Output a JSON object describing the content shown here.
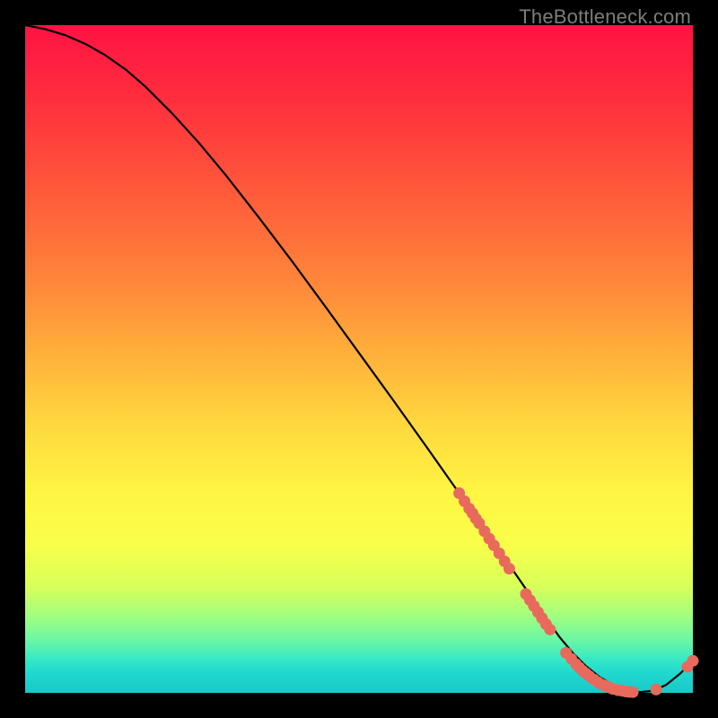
{
  "watermark": "TheBottleneck.com",
  "colors": {
    "dot": "#e86a5c",
    "curve": "#000000"
  },
  "chart_data": {
    "type": "line",
    "title": "",
    "xlabel": "",
    "ylabel": "",
    "xlim": [
      0,
      100
    ],
    "ylim": [
      0,
      100
    ],
    "grid": false,
    "legend": false,
    "series": [
      {
        "name": "curve",
        "x": [
          0,
          3,
          6,
          9,
          12,
          15,
          18,
          22,
          26,
          30,
          35,
          40,
          45,
          50,
          55,
          60,
          65,
          68,
          70,
          72,
          74,
          76,
          78,
          80,
          82,
          84,
          86,
          88,
          90,
          92,
          94,
          96,
          98,
          100
        ],
        "y": [
          100,
          99.4,
          98.5,
          97.2,
          95.5,
          93.4,
          90.8,
          86.8,
          82.4,
          77.6,
          71.2,
          64.6,
          57.8,
          50.9,
          44.0,
          37.0,
          29.9,
          25.6,
          22.8,
          19.9,
          17.0,
          14.1,
          11.2,
          8.4,
          6.0,
          4.0,
          2.4,
          1.2,
          0.4,
          0.1,
          0.3,
          1.2,
          2.8,
          4.8
        ]
      }
    ],
    "scatter": [
      {
        "name": "cluster1",
        "points": [
          {
            "x": 65.0,
            "y": 29.9
          },
          {
            "x": 65.8,
            "y": 28.7
          },
          {
            "x": 66.5,
            "y": 27.6
          },
          {
            "x": 67.0,
            "y": 26.9
          },
          {
            "x": 67.5,
            "y": 26.1
          },
          {
            "x": 68.0,
            "y": 25.4
          },
          {
            "x": 68.8,
            "y": 24.2
          },
          {
            "x": 69.5,
            "y": 23.1
          },
          {
            "x": 70.2,
            "y": 22.1
          },
          {
            "x": 71.0,
            "y": 20.9
          },
          {
            "x": 71.8,
            "y": 19.7
          },
          {
            "x": 72.5,
            "y": 18.6
          }
        ]
      },
      {
        "name": "cluster2",
        "points": [
          {
            "x": 75.0,
            "y": 14.8
          },
          {
            "x": 75.6,
            "y": 13.9
          },
          {
            "x": 76.2,
            "y": 13.0
          },
          {
            "x": 76.8,
            "y": 12.1
          },
          {
            "x": 77.4,
            "y": 11.2
          },
          {
            "x": 78.0,
            "y": 10.3
          },
          {
            "x": 78.6,
            "y": 9.5
          }
        ]
      },
      {
        "name": "cluster3",
        "points": [
          {
            "x": 81.0,
            "y": 6.0
          },
          {
            "x": 81.8,
            "y": 5.1
          },
          {
            "x": 82.5,
            "y": 4.3
          },
          {
            "x": 83.0,
            "y": 3.8
          },
          {
            "x": 83.5,
            "y": 3.3
          },
          {
            "x": 84.0,
            "y": 2.9
          },
          {
            "x": 84.5,
            "y": 2.5
          },
          {
            "x": 85.2,
            "y": 2.0
          },
          {
            "x": 85.8,
            "y": 1.6
          },
          {
            "x": 86.5,
            "y": 1.2
          },
          {
            "x": 87.0,
            "y": 1.0
          },
          {
            "x": 87.5,
            "y": 0.8
          },
          {
            "x": 88.0,
            "y": 0.6
          },
          {
            "x": 88.8,
            "y": 0.4
          },
          {
            "x": 89.5,
            "y": 0.3
          },
          {
            "x": 90.0,
            "y": 0.2
          },
          {
            "x": 90.5,
            "y": 0.15
          },
          {
            "x": 91.0,
            "y": 0.12
          }
        ]
      },
      {
        "name": "cluster4",
        "points": [
          {
            "x": 94.5,
            "y": 0.5
          }
        ]
      },
      {
        "name": "cluster5",
        "points": [
          {
            "x": 99.2,
            "y": 3.9
          },
          {
            "x": 100.0,
            "y": 4.8
          }
        ]
      }
    ]
  }
}
